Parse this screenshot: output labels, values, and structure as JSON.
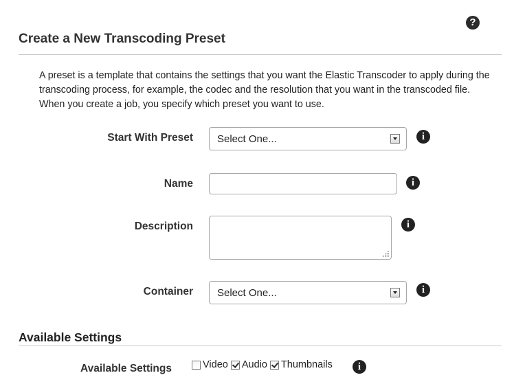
{
  "header": {
    "help_icon": "question-circle-icon",
    "help_glyph": "?"
  },
  "page": {
    "title": "Create a New Transcoding Preset",
    "intro": "A preset is a template that contains the settings that you want the Elastic Transcoder to apply during the transcoding process, for example, the codec and the resolution that you want in the transcoded file. When you create a job, you specify which preset you want to use."
  },
  "form": {
    "start_with_preset": {
      "label": "Start With Preset",
      "value": "Select One..."
    },
    "name": {
      "label": "Name",
      "value": ""
    },
    "description": {
      "label": "Description",
      "value": ""
    },
    "container": {
      "label": "Container",
      "value": "Select One..."
    },
    "info_icon": "info-circle-icon",
    "info_glyph": "i"
  },
  "available_settings": {
    "section_title": "Available Settings",
    "label": "Available Settings",
    "options": [
      {
        "label": "Video",
        "checked": false
      },
      {
        "label": "Audio",
        "checked": true
      },
      {
        "label": "Thumbnails",
        "checked": true
      }
    ]
  }
}
